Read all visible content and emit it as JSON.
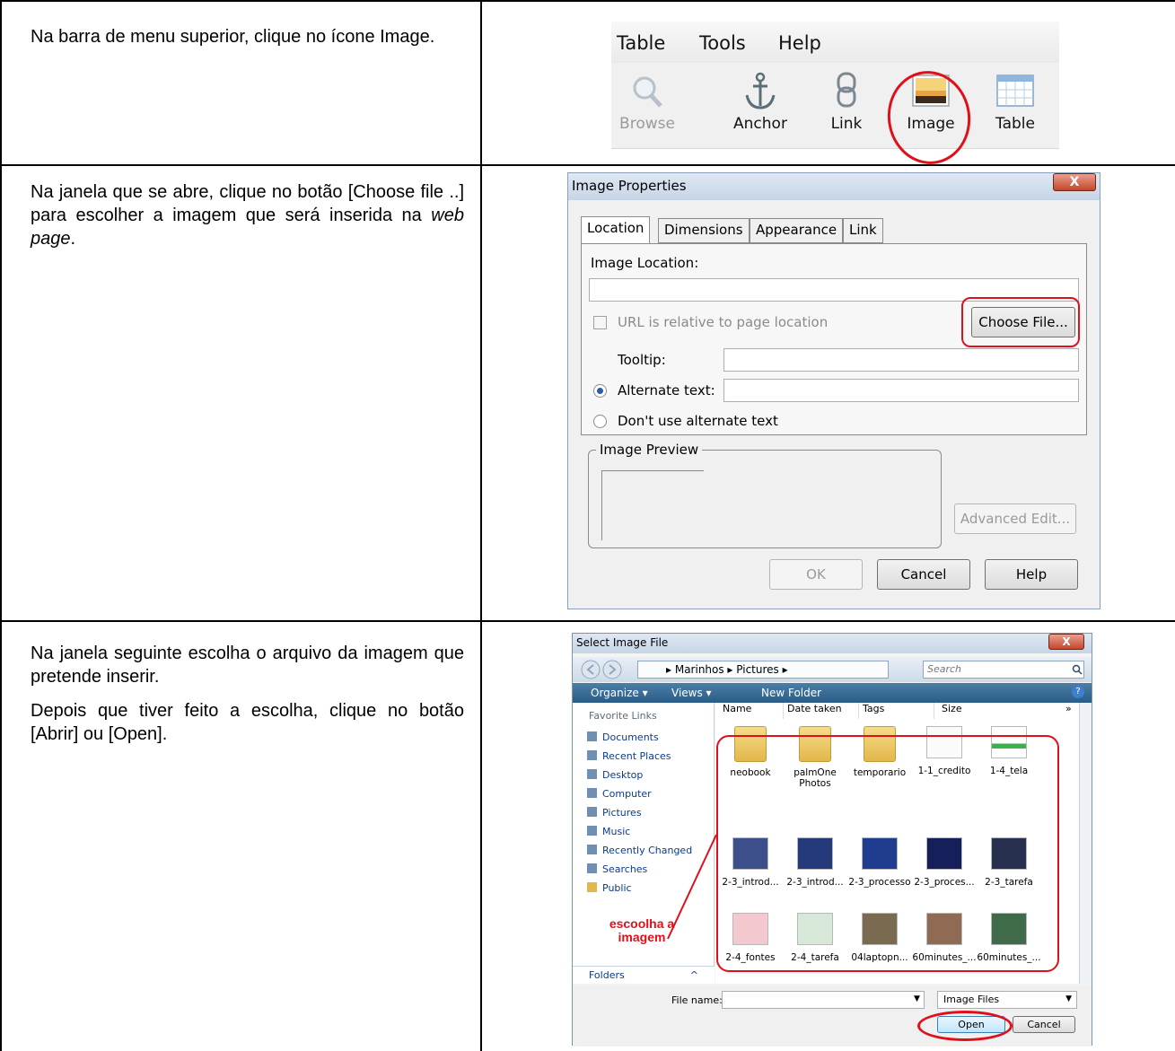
{
  "steps": [
    {
      "text_parts": [
        "Na barra de menu superior, clique no ícone Image."
      ]
    },
    {
      "text_parts": [
        "Na janela que se abre, clique no botão [Choose file ..] para escolher a imagem que será inserida na ",
        "web page",
        "."
      ]
    },
    {
      "text_parts": [
        "Na janela seguinte escolha o arquivo da imagem que pretende inserir.",
        "Depois que tiver feito a escolha, clique no botão [Abrir] ou [Open]."
      ]
    }
  ],
  "toolbar": {
    "menus": [
      "Table",
      "Tools",
      "Help"
    ],
    "buttons": [
      {
        "label": "Browse",
        "icon": "magnifier-icon",
        "enabled": false
      },
      {
        "label": "Anchor",
        "icon": "anchor-icon",
        "enabled": true
      },
      {
        "label": "Link",
        "icon": "chain-link-icon",
        "enabled": true
      },
      {
        "label": "Image",
        "icon": "image-icon",
        "enabled": true,
        "highlighted": true
      },
      {
        "label": "Table",
        "icon": "table-icon",
        "enabled": true
      }
    ]
  },
  "image_properties": {
    "title": "Image Properties",
    "close": "X",
    "tabs": [
      "Location",
      "Dimensions",
      "Appearance",
      "Link"
    ],
    "active_tab": "Location",
    "image_location_label": "Image Location:",
    "image_location_value": "",
    "url_relative_label": "URL is relative to page location",
    "choose_file_button": "Choose File...",
    "tooltip_label": "Tooltip:",
    "alternate_text_label": "Alternate text:",
    "dont_use_alt_label": "Don't use alternate text",
    "image_preview_label": "Image Preview",
    "advanced_edit_button": "Advanced Edit...",
    "ok_button": "OK",
    "cancel_button": "Cancel",
    "help_button": "Help"
  },
  "select_image_file": {
    "title": "Select Image File",
    "close": "X",
    "breadcrumb": "▸ Marinhos ▸ Pictures ▸",
    "search_placeholder": "Search",
    "organize": "Organize ▾",
    "views": "Views ▾",
    "new_folder": "New Folder",
    "favorite_links_header": "Favorite Links",
    "favorite_links": [
      "Documents",
      "Recent Places",
      "Desktop",
      "Computer",
      "Pictures",
      "Music",
      "Recently Changed",
      "Searches",
      "Public"
    ],
    "folders_label": "Folders",
    "columns": [
      "Name",
      "Date taken",
      "Tags",
      "Size"
    ],
    "items": [
      {
        "name": "neobook",
        "kind": "folder"
      },
      {
        "name": "palmOne Photos",
        "kind": "folder"
      },
      {
        "name": "temporario",
        "kind": "folder"
      },
      {
        "name": "1-1_credito",
        "kind": "image"
      },
      {
        "name": "1-4_tela",
        "kind": "image"
      },
      {
        "name": "2-3_introd...",
        "kind": "image"
      },
      {
        "name": "2-3_introd...",
        "kind": "image"
      },
      {
        "name": "2-3_processo",
        "kind": "image"
      },
      {
        "name": "2-3_proces...",
        "kind": "image"
      },
      {
        "name": "2-3_tarefa",
        "kind": "image"
      },
      {
        "name": "2-4_fontes",
        "kind": "image"
      },
      {
        "name": "2-4_tarefa",
        "kind": "image"
      },
      {
        "name": "04laptopn...",
        "kind": "image"
      },
      {
        "name": "60minutes_...",
        "kind": "image"
      },
      {
        "name": "60minutes_...",
        "kind": "image"
      }
    ],
    "file_name_label": "File name:",
    "file_name_value": "",
    "file_type": "Image Files",
    "open_button": "Open",
    "cancel_button": "Cancel",
    "annotation": [
      "escoolha a",
      "imagem"
    ]
  },
  "colors": {
    "highlight": "#e0101a",
    "titlebar": "#c6d5e6",
    "command_bar": "#2a5c86"
  }
}
